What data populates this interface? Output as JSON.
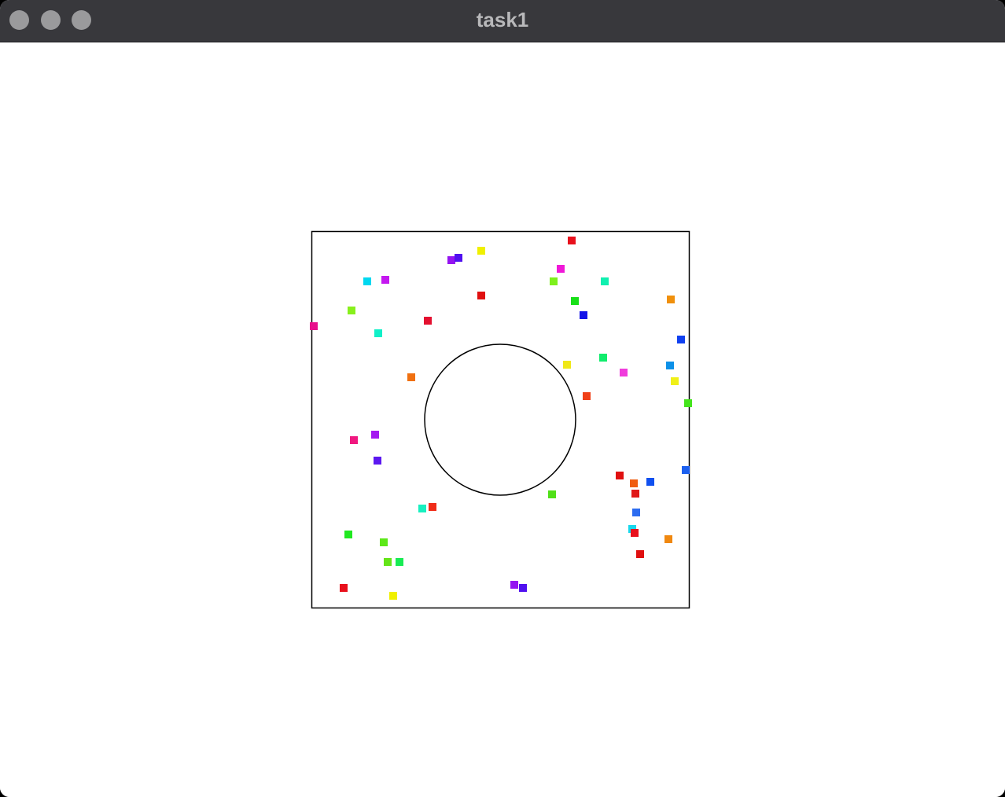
{
  "window": {
    "title": "task1"
  },
  "scene": {
    "box_stroke": "#000000",
    "circle_stroke": "#000000",
    "particle_colors": [
      "#e8101c",
      "#f0f000",
      "#9414f0",
      "#5010f0",
      "#00d8f0",
      "#c418f0",
      "#f018d8",
      "#7ef01c",
      "#10f0b0",
      "#e01010",
      "#18e018",
      "#f0900c",
      "#1414e8",
      "#88f01c",
      "#e8108c",
      "#e41030",
      "#10f0c8",
      "#1040f0",
      "#f0e818",
      "#10ec6c",
      "#f03cdc",
      "#f04018",
      "#0c90e8",
      "#f07010",
      "#f0f018",
      "#44e41c",
      "#a418f0",
      "#f01880",
      "#5c18f0",
      "#1c60f0",
      "#e01010",
      "#f05c10",
      "#50e018",
      "#1050f0",
      "#e01818",
      "#2c6cf0",
      "#18d8ec",
      "#e8101c",
      "#f08810",
      "#18f0c0",
      "#f02c18",
      "#20e820",
      "#5ce818",
      "#64e418",
      "#18ec54",
      "#e01010"
    ]
  }
}
